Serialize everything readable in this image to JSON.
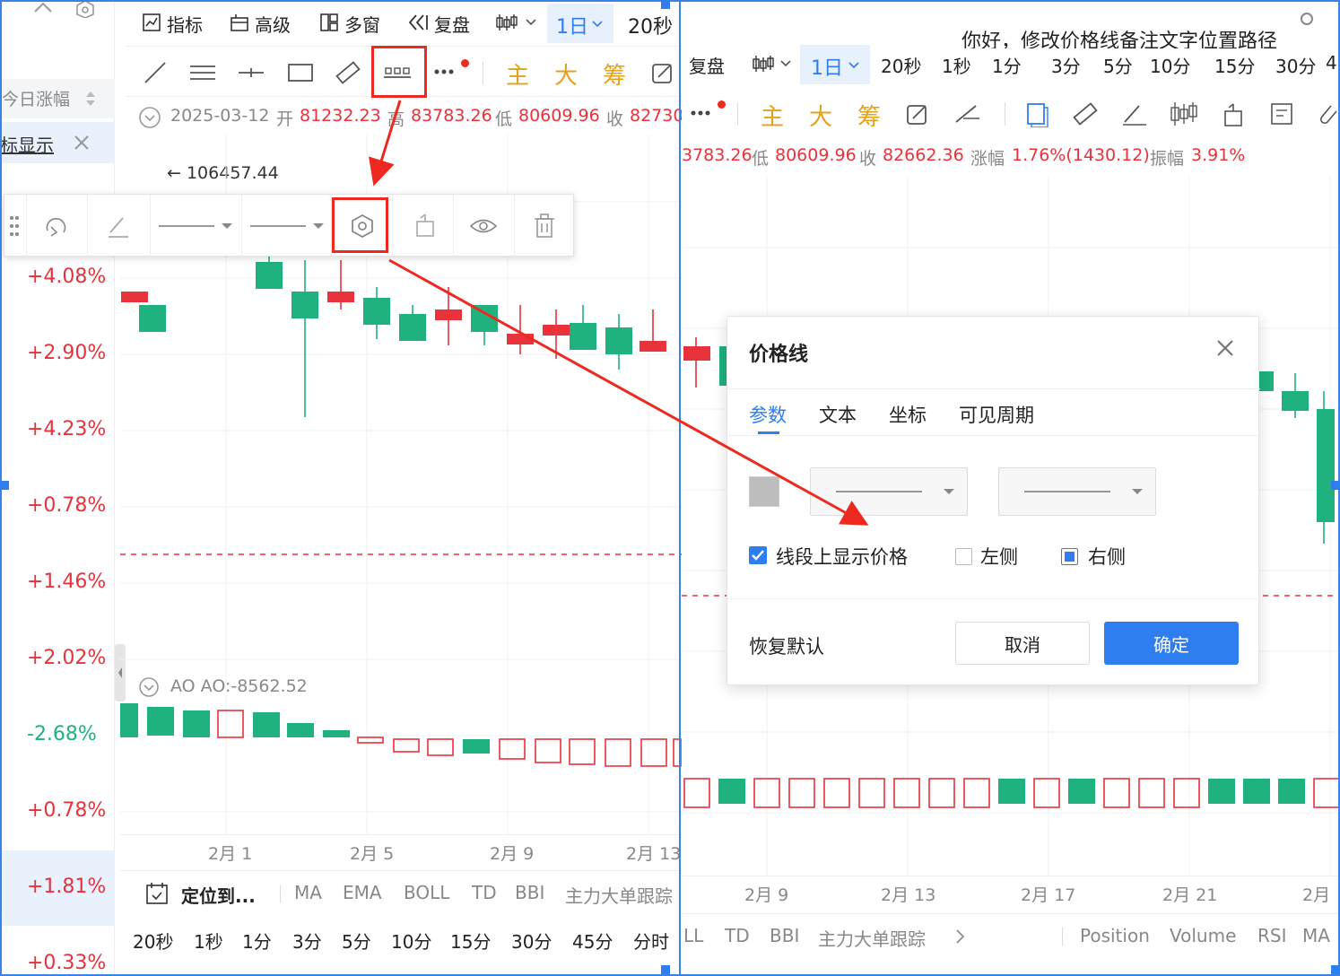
{
  "left_window": {
    "toolbar1": {
      "indicator": "指标",
      "advanced": "高级",
      "multiwindow": "多窗",
      "replay": "复盘",
      "period_selected": "1日",
      "sec20": "20秒"
    },
    "gold_tools": [
      "主",
      "大",
      "筹"
    ],
    "ohlc": {
      "date": "2025-03-12",
      "open_label": "开",
      "open": "81232.23",
      "high_label": "高",
      "high": "83783.26",
      "low_label": "低",
      "low": "80609.96",
      "close_label": "收",
      "close": "82730"
    },
    "max_label": "← 106457.44",
    "left_panel": {
      "today_change": "今日涨幅",
      "show_label": "标显示",
      "percents": [
        {
          "v": "+4.08%",
          "c": "red"
        },
        {
          "v": "+2.90%",
          "c": "red"
        },
        {
          "v": "+4.23%",
          "c": "red"
        },
        {
          "v": "+0.78%",
          "c": "red"
        },
        {
          "v": "+1.46%",
          "c": "red"
        },
        {
          "v": "+2.02%",
          "c": "red"
        },
        {
          "v": "-2.68%",
          "c": "green"
        },
        {
          "v": "+0.78%",
          "c": "red"
        },
        {
          "v": "+1.81%",
          "c": "red"
        },
        {
          "v": "+0.33%",
          "c": "red"
        }
      ]
    },
    "ao_label": "AO  AO:-8562.52",
    "dates": [
      "2月 1",
      "2月 5",
      "2月 9",
      "2月 13"
    ],
    "bottom_indicators": [
      "定位到...",
      "MA",
      "EMA",
      "BOLL",
      "TD",
      "BBI",
      "主力大单跟踪"
    ],
    "bottom_periods": [
      "20秒",
      "1秒",
      "1分",
      "3分",
      "5分",
      "10分",
      "15分",
      "30分",
      "45分",
      "分时"
    ]
  },
  "right_window": {
    "header_text": "你好，修改价格线备注文字位置路径",
    "toolbar1": {
      "replay": "复盘",
      "period_selected": "1日",
      "periods": [
        "20秒",
        "1秒",
        "1分",
        "3分",
        "5分",
        "10分",
        "15分",
        "30分",
        "4"
      ]
    },
    "gold_tools": [
      "主",
      "大",
      "筹"
    ],
    "ohlc_row": {
      "high_tail": "3783.26",
      "low_label": "低",
      "low": "80609.96",
      "close_label": "收",
      "close": "82662.36",
      "change_label": "涨幅",
      "change": "1.76%(1430.12)",
      "amp_label": "振幅",
      "amp": "3.91%"
    },
    "dates": [
      "2月 9",
      "2月 13",
      "2月 17",
      "2月 21",
      "2月"
    ],
    "bottom_indicators": [
      "LL",
      "TD",
      "BBI",
      "主力大单跟踪",
      "Position",
      "Volume",
      "RSI",
      "MA"
    ]
  },
  "dialog": {
    "title": "价格线",
    "tabs": [
      "参数",
      "文本",
      "坐标",
      "可见周期"
    ],
    "show_price_label": "线段上显示价格",
    "left_label": "左侧",
    "right_label": "右侧",
    "reset": "恢复默认",
    "cancel": "取消",
    "ok": "确定",
    "accent": "#2f7ef0"
  },
  "colors": {
    "up": "#e8323c",
    "down": "#1fb17e",
    "annotation": "#ee2a20"
  }
}
